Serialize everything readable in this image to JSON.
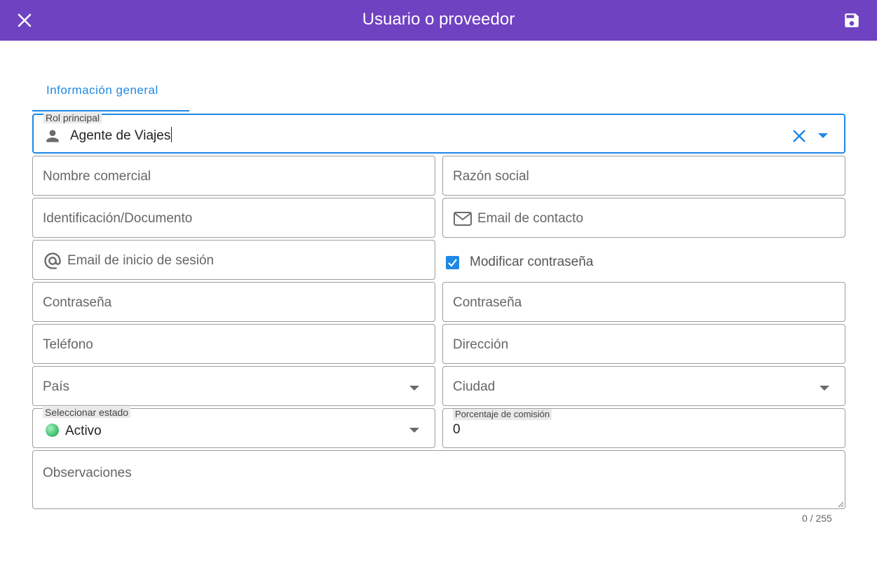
{
  "header": {
    "title": "Usuario o proveedor",
    "accent_color": "#6f42c1"
  },
  "tabs": [
    {
      "label": "Información general",
      "active": true
    }
  ],
  "form": {
    "rol_principal": {
      "label": "Rol principal",
      "value": "Agente de Viajes",
      "icon": "person-icon"
    },
    "nombre_comercial": "Nombre comercial",
    "razon_social": "Razón social",
    "identificacion": "Identificación/Documento",
    "email_contacto": {
      "placeholder": "Email de contacto",
      "icon": "mail-icon"
    },
    "email_sesion": {
      "placeholder": "Email de inicio de sesión",
      "icon": "at-icon"
    },
    "modificar_contrasena": {
      "label": "Modificar contraseña",
      "checked": true
    },
    "contrasena_1": "Contraseña",
    "contrasena_2": "Contraseña",
    "telefono": "Teléfono",
    "direccion": "Dirección",
    "pais": "País",
    "ciudad": "Ciudad",
    "estado": {
      "label": "Seleccionar estado",
      "value": "Activo",
      "status_color": "#4cc77a"
    },
    "comision": {
      "label": "Porcentaje de comisión",
      "value": "0"
    },
    "observaciones": {
      "placeholder": "Observaciones",
      "counter": "0 / 255"
    }
  },
  "colors": {
    "primary": "#1e88e5",
    "border": "#9e9e9e"
  }
}
